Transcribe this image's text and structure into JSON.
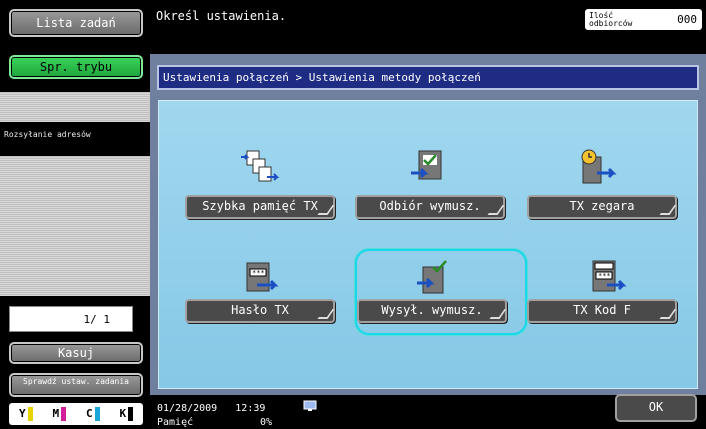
{
  "sidebar": {
    "job_list": "Lista zadań",
    "mode_check": "Spr. trybu",
    "section_label": "Rozsyłanie adresów",
    "page_counter": "1/ 1",
    "delete": "Kasuj",
    "check_settings": "Sprawdź ustaw. zadania",
    "toner": {
      "y": "Y",
      "m": "M",
      "c": "C",
      "k": "K",
      "colors": {
        "y": "#e6d200",
        "m": "#d21e9b",
        "c": "#18a7d8",
        "k": "#000000"
      }
    }
  },
  "header": {
    "prompt": "Określ ustawienia.",
    "recipients_label": "Ilość odbiorców",
    "recipients_count": "000"
  },
  "breadcrumb": "Ustawienia połączeń > Ustawienia metody połączeń",
  "options": [
    {
      "label": "Szybka pamięć TX",
      "icon": "quick-memory-tx-icon"
    },
    {
      "label": "Odbiór wymusz.",
      "icon": "polling-rx-icon"
    },
    {
      "label": "TX zegara",
      "icon": "timer-tx-icon"
    },
    {
      "label": "Hasło TX",
      "icon": "password-tx-icon"
    },
    {
      "label": "Wysył. wymusz.",
      "icon": "polling-tx-icon",
      "selected": true
    },
    {
      "label": "TX Kod F",
      "icon": "f-code-tx-icon"
    }
  ],
  "footer": {
    "date": "01/28/2009",
    "time": "12:39",
    "memory_label": "Pamięć",
    "memory_value": "0%",
    "ok": "OK"
  },
  "colors": {
    "panel_bg": "#6f7f9e",
    "inner_bg": "#93cfe9",
    "breadcrumb_bg": "#1e2d83",
    "selection_ring": "#19d8e8",
    "mode_button": "#2bbd4a"
  }
}
